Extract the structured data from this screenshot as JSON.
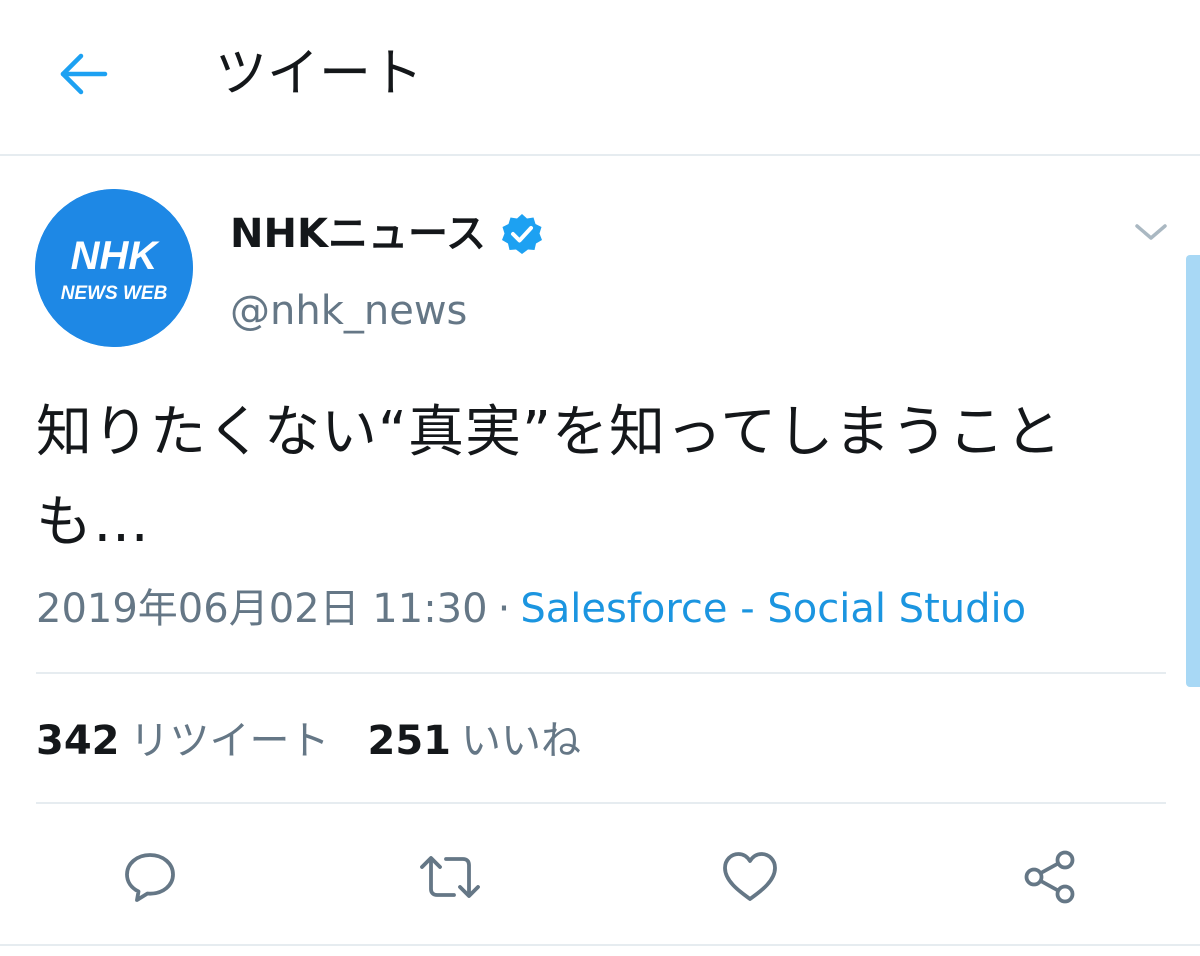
{
  "header": {
    "title": "ツイート",
    "back_icon": "arrow-left-icon"
  },
  "tweet": {
    "avatar": {
      "logo_text": "NHK",
      "logo_subtext": "NEWS WEB",
      "bg_color": "#1e88e5"
    },
    "display_name": "NHKニュース",
    "verified": true,
    "handle": "@nhk_news",
    "text": "知りたくない“真実”を知ってしまうことも…",
    "timestamp": "2019年06月02日 11:30",
    "separator": "·",
    "source": "Salesforce - Social Studio",
    "stats": {
      "retweets_count": "342",
      "retweets_label": "リツイート",
      "likes_count": "251",
      "likes_label": "いいね"
    },
    "actions": [
      {
        "name": "reply",
        "icon": "reply-icon"
      },
      {
        "name": "retweet",
        "icon": "retweet-icon"
      },
      {
        "name": "like",
        "icon": "heart-icon"
      },
      {
        "name": "share",
        "icon": "share-icon"
      }
    ]
  },
  "colors": {
    "accent": "#1da1f2",
    "link": "#1b95e0",
    "secondary_text": "#657786",
    "primary_text": "#14171a",
    "divider": "#e6ecf0"
  }
}
